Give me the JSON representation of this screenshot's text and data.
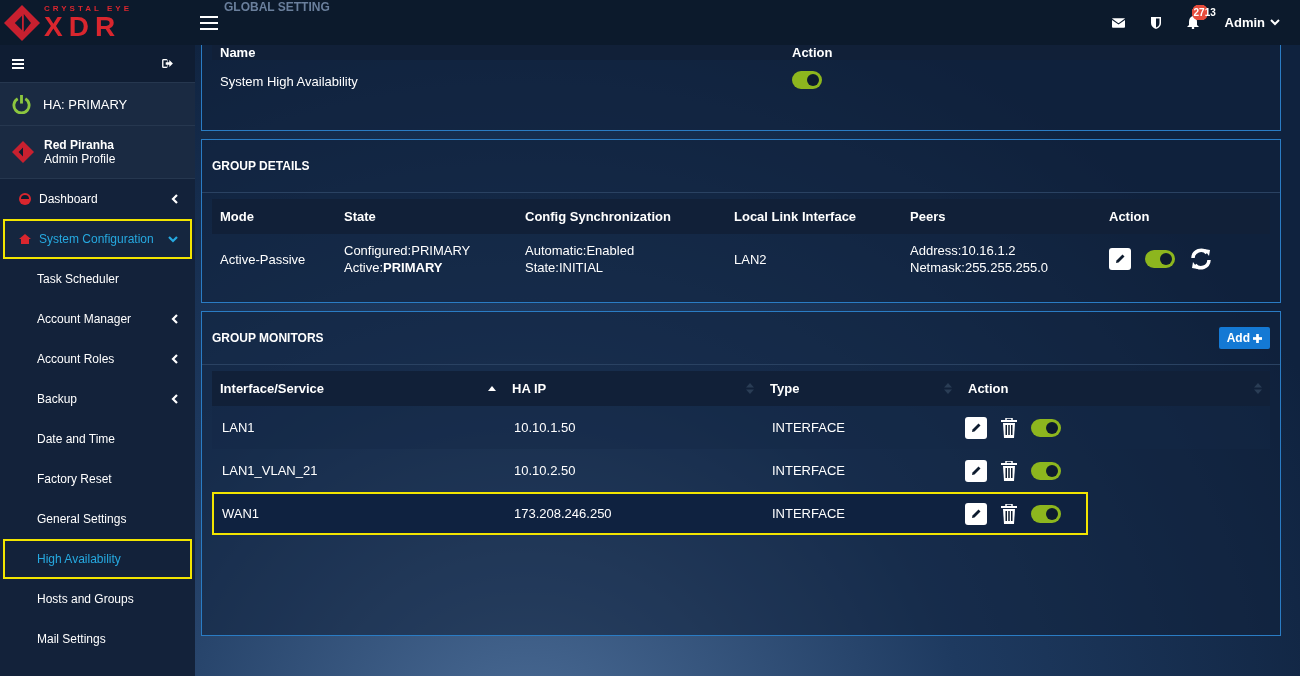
{
  "brand": {
    "top": "CRYSTAL EYE",
    "main": "XDR"
  },
  "header": {
    "notifications": "2713",
    "user": "Admin"
  },
  "sidebar": {
    "ha_status": "HA: PRIMARY",
    "profile": {
      "name": "Red Piranha",
      "role": "Admin Profile"
    },
    "items": [
      {
        "label": "Dashboard",
        "kind": "dashboard",
        "expanded": false,
        "selected": false,
        "highlighted": false
      },
      {
        "label": "System Configuration",
        "kind": "section",
        "expanded": true,
        "selected": true,
        "highlighted": true
      },
      {
        "label": "Task Scheduler",
        "kind": "sub",
        "selected": false,
        "highlighted": false
      },
      {
        "label": "Account Manager",
        "kind": "subgroup",
        "expanded": false,
        "selected": false,
        "highlighted": false
      },
      {
        "label": "Account Roles",
        "kind": "subgroup",
        "expanded": false,
        "selected": false,
        "highlighted": false
      },
      {
        "label": "Backup",
        "kind": "subgroup",
        "expanded": false,
        "selected": false,
        "highlighted": false
      },
      {
        "label": "Date and Time",
        "kind": "sub",
        "selected": false,
        "highlighted": false
      },
      {
        "label": "Factory Reset",
        "kind": "sub",
        "selected": false,
        "highlighted": false
      },
      {
        "label": "General Settings",
        "kind": "sub",
        "selected": false,
        "highlighted": false
      },
      {
        "label": "High Availability",
        "kind": "sub",
        "selected": true,
        "highlighted": true
      },
      {
        "label": "Hosts and Groups",
        "kind": "sub",
        "selected": false,
        "highlighted": false
      },
      {
        "label": "Mail Settings",
        "kind": "sub",
        "selected": false,
        "highlighted": false
      }
    ]
  },
  "global_setting": {
    "title": "GLOBAL SETTING",
    "columns": [
      "Name",
      "Action"
    ],
    "rows": [
      {
        "name": "System High Availability",
        "on": true
      }
    ]
  },
  "group_details": {
    "title": "GROUP DETAILS",
    "columns": [
      "Mode",
      "State",
      "Config Synchronization",
      "Local Link Interface",
      "Peers",
      "Action"
    ],
    "rows": [
      {
        "mode": "Active-Passive",
        "state": [
          "Configured:PRIMARY",
          "Active:**PRIMARY**"
        ],
        "sync": [
          "Automatic:Enabled",
          "State:INITIAL"
        ],
        "interface": "LAN2",
        "peers": [
          "Address:10.16.1.2",
          "Netmask:255.255.255.0"
        ],
        "on": true
      }
    ]
  },
  "group_monitors": {
    "title": "GROUP MONITORS",
    "add_button": "Add",
    "columns": [
      "Interface/Service",
      "HA IP",
      "Type",
      "Action"
    ],
    "rows": [
      {
        "interface": "LAN1",
        "ha_ip": "10.10.1.50",
        "type": "INTERFACE",
        "on": true,
        "highlighted": false
      },
      {
        "interface": "LAN1_VLAN_21",
        "ha_ip": "10.10.2.50",
        "type": "INTERFACE",
        "on": true,
        "highlighted": false
      },
      {
        "interface": "WAN1",
        "ha_ip": "173.208.246.250",
        "type": "INTERFACE",
        "on": true,
        "highlighted": true
      }
    ]
  }
}
